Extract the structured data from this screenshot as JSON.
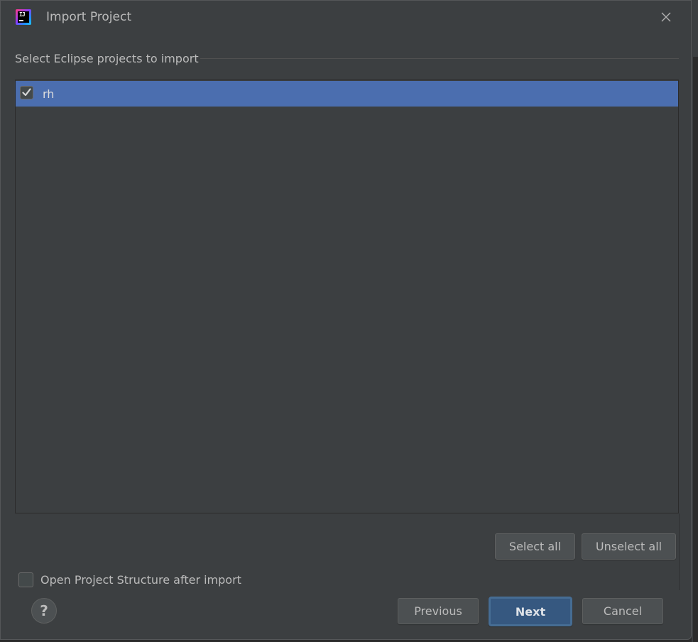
{
  "window": {
    "title": "Import Project",
    "app_icon": "intellij-idea-icon",
    "close_icon": "close-icon"
  },
  "section": {
    "label": "Select Eclipse projects to import"
  },
  "projects": [
    {
      "name": "rh",
      "checked": true,
      "selected": true
    }
  ],
  "list_actions": {
    "select_all": "Select all",
    "unselect_all": "Unselect all"
  },
  "options": {
    "open_structure_label": "Open Project Structure after import",
    "open_structure_checked": false
  },
  "footer": {
    "help_label": "?",
    "previous": "Previous",
    "next": "Next",
    "cancel": "Cancel"
  },
  "colors": {
    "selection": "#4b6eaf",
    "default_button": "#365880",
    "background": "#3c3f41"
  }
}
